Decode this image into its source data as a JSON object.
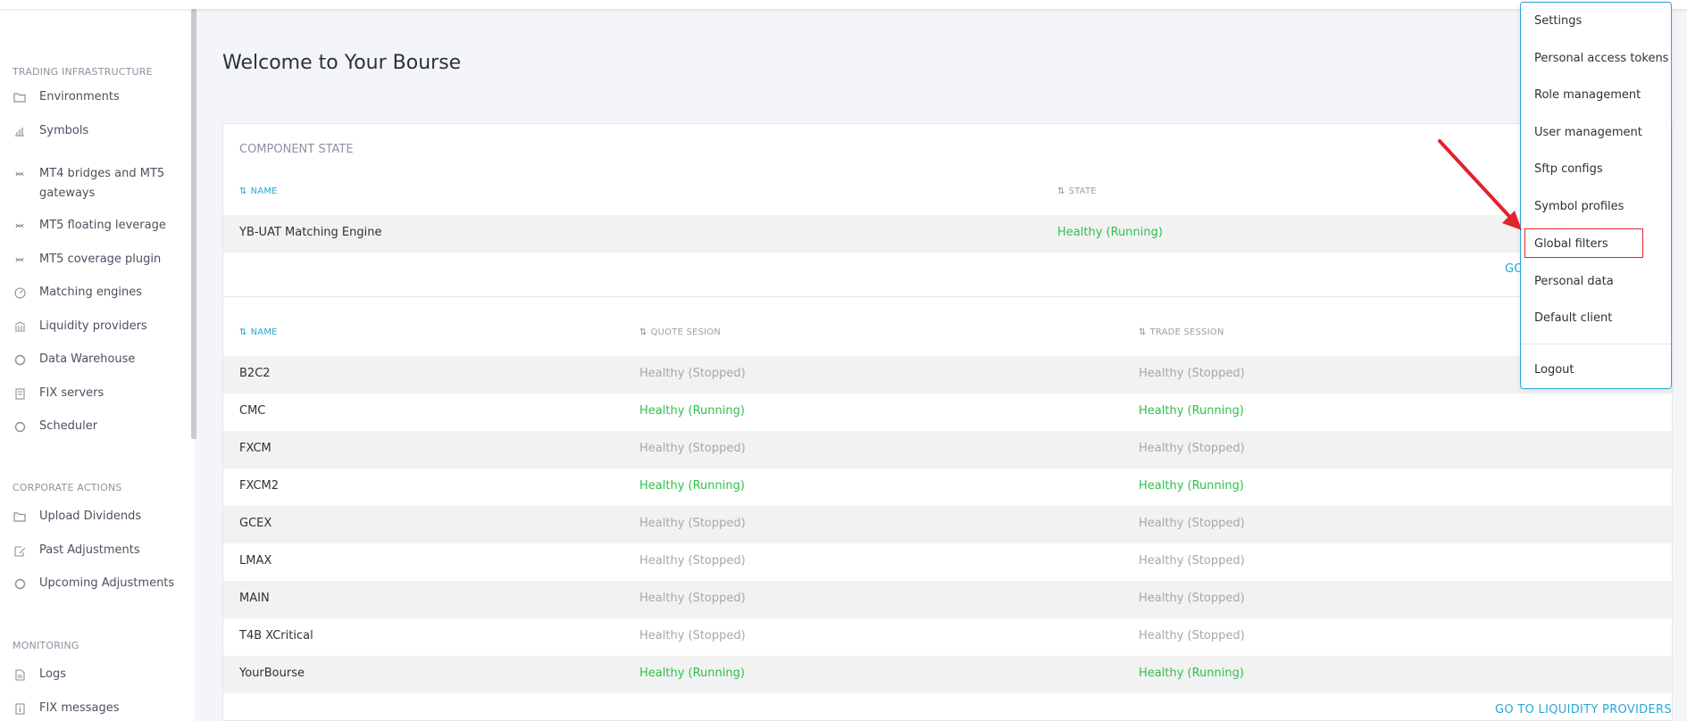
{
  "sidebar": {
    "sections": [
      {
        "title": "TRADING INFRASTRUCTURE",
        "items": [
          {
            "label": "Environments",
            "icon": "folder-icon"
          },
          {
            "label": "Symbols",
            "icon": "bar-chart-icon"
          },
          {
            "label": "MT4 bridges and MT5 gateways",
            "icon": "link-icon"
          },
          {
            "label": "MT5 floating leverage",
            "icon": "link-icon"
          },
          {
            "label": "MT5 coverage plugin",
            "icon": "link-icon"
          },
          {
            "label": "Matching engines",
            "icon": "gauge-icon"
          },
          {
            "label": "Liquidity providers",
            "icon": "bank-icon"
          },
          {
            "label": "Data Warehouse",
            "icon": "circle-icon"
          },
          {
            "label": "FIX servers",
            "icon": "server-icon"
          },
          {
            "label": "Scheduler",
            "icon": "circle-icon"
          }
        ]
      },
      {
        "title": "CORPORATE ACTIONS",
        "items": [
          {
            "label": "Upload Dividends",
            "icon": "folder-icon"
          },
          {
            "label": "Past Adjustments",
            "icon": "edit-icon"
          },
          {
            "label": "Upcoming Adjustments",
            "icon": "circle-icon"
          }
        ]
      },
      {
        "title": "MONITORING",
        "items": [
          {
            "label": "Logs",
            "icon": "document-icon"
          },
          {
            "label": "FIX messages",
            "icon": "info-icon"
          }
        ]
      }
    ]
  },
  "page": {
    "title": "Welcome to Your Bourse"
  },
  "component_state": {
    "title": "COMPONENT STATE",
    "headers": {
      "name": "NAME",
      "state": "STATE"
    },
    "rows": [
      {
        "name": "YB-UAT Matching Engine",
        "state": "Healthy (Running)"
      }
    ],
    "link": "GO"
  },
  "lp_table": {
    "headers": {
      "name": "NAME",
      "quote": "QUOTE SESION",
      "trade": "TRADE SESSION"
    },
    "rows": [
      {
        "name": "B2C2",
        "quote": "Healthy (Stopped)",
        "trade": "Healthy (Stopped)"
      },
      {
        "name": "CMC",
        "quote": "Healthy (Running)",
        "trade": "Healthy (Running)"
      },
      {
        "name": "FXCM",
        "quote": "Healthy (Stopped)",
        "trade": "Healthy (Stopped)"
      },
      {
        "name": "FXCM2",
        "quote": "Healthy (Running)",
        "trade": "Healthy (Running)"
      },
      {
        "name": "GCEX",
        "quote": "Healthy (Stopped)",
        "trade": "Healthy (Stopped)"
      },
      {
        "name": "LMAX",
        "quote": "Healthy (Stopped)",
        "trade": "Healthy (Stopped)"
      },
      {
        "name": "MAIN",
        "quote": "Healthy (Stopped)",
        "trade": "Healthy (Stopped)"
      },
      {
        "name": "T4B XCritical",
        "quote": "Healthy (Stopped)",
        "trade": "Healthy (Stopped)"
      },
      {
        "name": "YourBourse",
        "quote": "Healthy (Running)",
        "trade": "Healthy (Running)"
      }
    ],
    "link": "GO TO LIQUIDITY PROVIDERS"
  },
  "user_menu": {
    "items": [
      "Settings",
      "Personal access tokens",
      "Role management",
      "User management",
      "Sftp configs",
      "Symbol profiles",
      "Global filters",
      "Personal data",
      "Default client"
    ],
    "logout": "Logout",
    "highlighted": "Global filters"
  },
  "colors": {
    "accent": "#2aa6d6",
    "running": "#2ec24a",
    "stopped": "#a3a8b0",
    "annotation": "#e0242b"
  }
}
